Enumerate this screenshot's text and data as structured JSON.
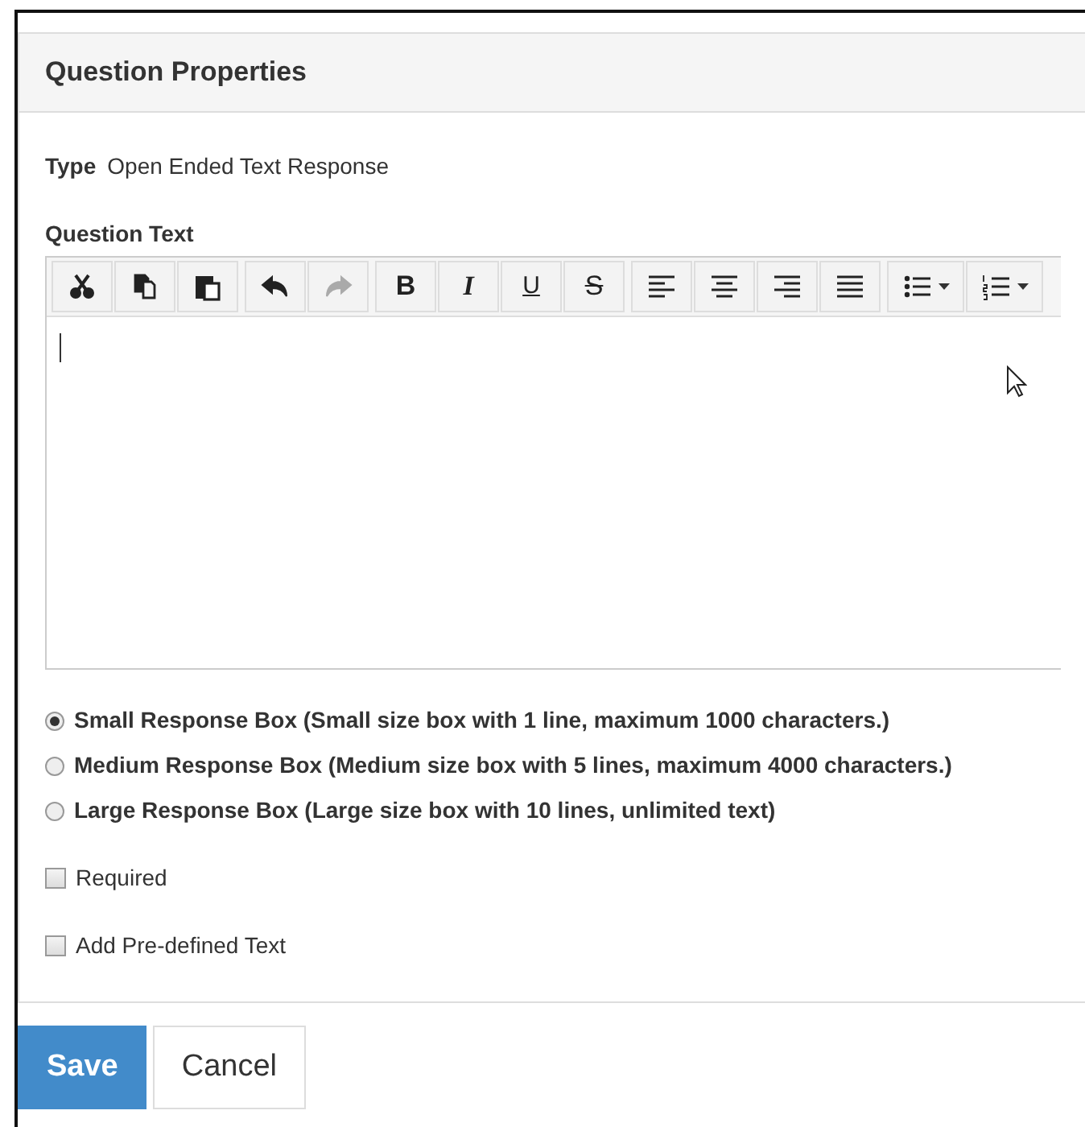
{
  "panel": {
    "title": "Question Properties"
  },
  "type": {
    "label": "Type",
    "value": "Open Ended Text Response"
  },
  "question_text": {
    "label": "Question Text",
    "toolbar": [
      [
        {
          "kind": "cut",
          "disabled": false
        },
        {
          "kind": "copy",
          "disabled": false
        },
        {
          "kind": "paste",
          "disabled": false
        }
      ],
      [
        {
          "kind": "undo",
          "disabled": false
        },
        {
          "kind": "redo",
          "disabled": true
        }
      ],
      [
        {
          "kind": "bold",
          "label": "B",
          "disabled": false
        },
        {
          "kind": "italic",
          "label": "I",
          "disabled": false
        },
        {
          "kind": "underline",
          "label": "U",
          "disabled": false
        },
        {
          "kind": "strike",
          "label": "S",
          "disabled": false
        }
      ],
      [
        {
          "kind": "align-left",
          "disabled": false
        },
        {
          "kind": "align-center",
          "disabled": false
        },
        {
          "kind": "align-right",
          "disabled": false
        },
        {
          "kind": "justify",
          "disabled": false
        }
      ],
      [
        {
          "kind": "bullet-list",
          "dropdown": true,
          "disabled": false
        },
        {
          "kind": "numbered-list",
          "dropdown": true,
          "disabled": false
        }
      ]
    ]
  },
  "response_sizes": [
    {
      "label": "Small Response Box (Small size box with 1 line, maximum 1000 characters.)",
      "selected": true
    },
    {
      "label": "Medium Response Box (Medium size box with 5 lines, maximum 4000 characters.)",
      "selected": false
    },
    {
      "label": "Large Response Box (Large size box with 10 lines, unlimited text)",
      "selected": false
    }
  ],
  "options": [
    {
      "label": "Required",
      "checked": false
    },
    {
      "label": "Add Pre-defined Text",
      "checked": false
    }
  ],
  "buttons": [
    {
      "label": "Save",
      "kind": "primary"
    },
    {
      "label": "Cancel",
      "kind": "default"
    }
  ]
}
